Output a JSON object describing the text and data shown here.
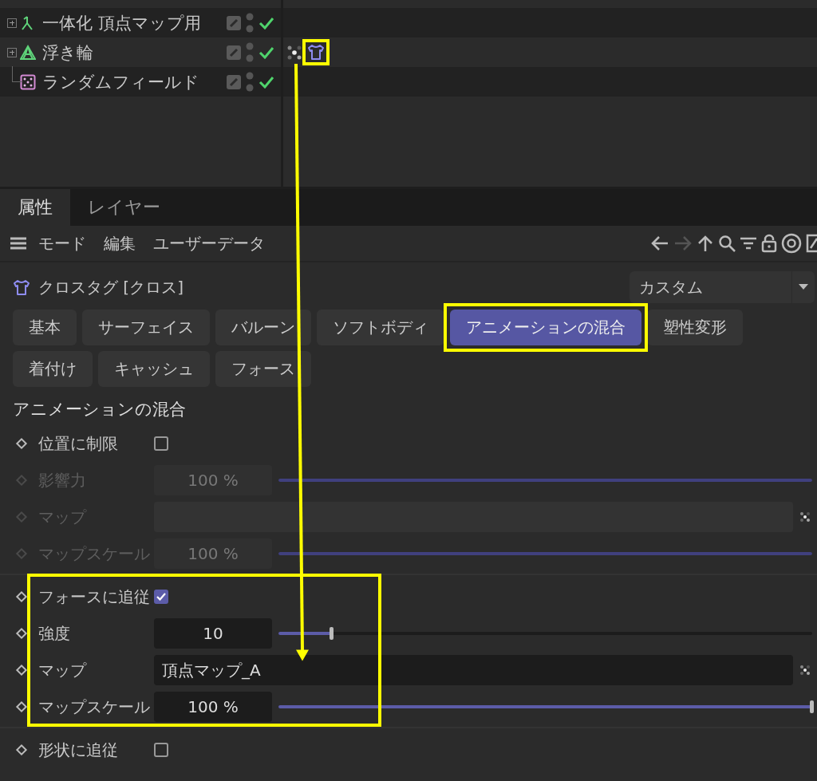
{
  "objects": [
    {
      "name": "一体化 頂点マップ用",
      "kind": "connect",
      "expandable": true
    },
    {
      "name": "浮き輪",
      "kind": "polygon",
      "expandable": true,
      "tags": [
        {
          "kind": "vertex-map"
        },
        {
          "kind": "cloth"
        }
      ]
    },
    {
      "name": "ランダムフィールド",
      "kind": "random",
      "expandable": false
    }
  ],
  "tabs": [
    {
      "label": "属性",
      "selected": true
    },
    {
      "label": "レイヤー",
      "selected": false
    }
  ],
  "menu": [
    "モード",
    "編集",
    "ユーザーデータ"
  ],
  "title": "クロスタグ [クロス]",
  "preset": "カスタム",
  "page_buttons": [
    [
      {
        "label": "基本",
        "selected": false
      },
      {
        "label": "サーフェイス",
        "selected": false
      },
      {
        "label": "バルーン",
        "selected": false
      },
      {
        "label": "ソフトボディ",
        "selected": false
      },
      {
        "label": "アニメーションの混合",
        "selected": true
      },
      {
        "label": "塑性変形",
        "selected": false
      }
    ],
    [
      {
        "label": "着付け",
        "selected": false
      },
      {
        "label": "キャッシュ",
        "selected": false
      },
      {
        "label": "フォース",
        "selected": false
      }
    ]
  ],
  "section": "アニメーションの混合",
  "groups": [
    {
      "rows": [
        {
          "kind": "checkbox",
          "label": "位置に制限",
          "checked": false,
          "disabled": false
        },
        {
          "kind": "slider",
          "label": "影響力",
          "value": "100 %",
          "level": 1,
          "disabled": true
        },
        {
          "kind": "link",
          "label": "マップ",
          "disabled": true
        },
        {
          "kind": "slider",
          "label": "マップスケール",
          "value": "100 %",
          "level": 1,
          "disabled": true
        }
      ]
    },
    {
      "rows": [
        {
          "kind": "checkbox",
          "label": "フォースに追従",
          "checked": true,
          "disabled": false
        },
        {
          "kind": "slider",
          "label": "強度",
          "value": "10",
          "level": 0.1,
          "disabled": false
        },
        {
          "kind": "link",
          "label": "マップ",
          "value": "頂点マップ_A",
          "disabled": false
        },
        {
          "kind": "slider",
          "label": "マップスケール",
          "value": "100 %",
          "level": 1,
          "disabled": false
        }
      ]
    },
    {
      "rows": [
        {
          "kind": "checkbox",
          "label": "形状に追従",
          "checked": false,
          "disabled": false
        }
      ]
    }
  ]
}
